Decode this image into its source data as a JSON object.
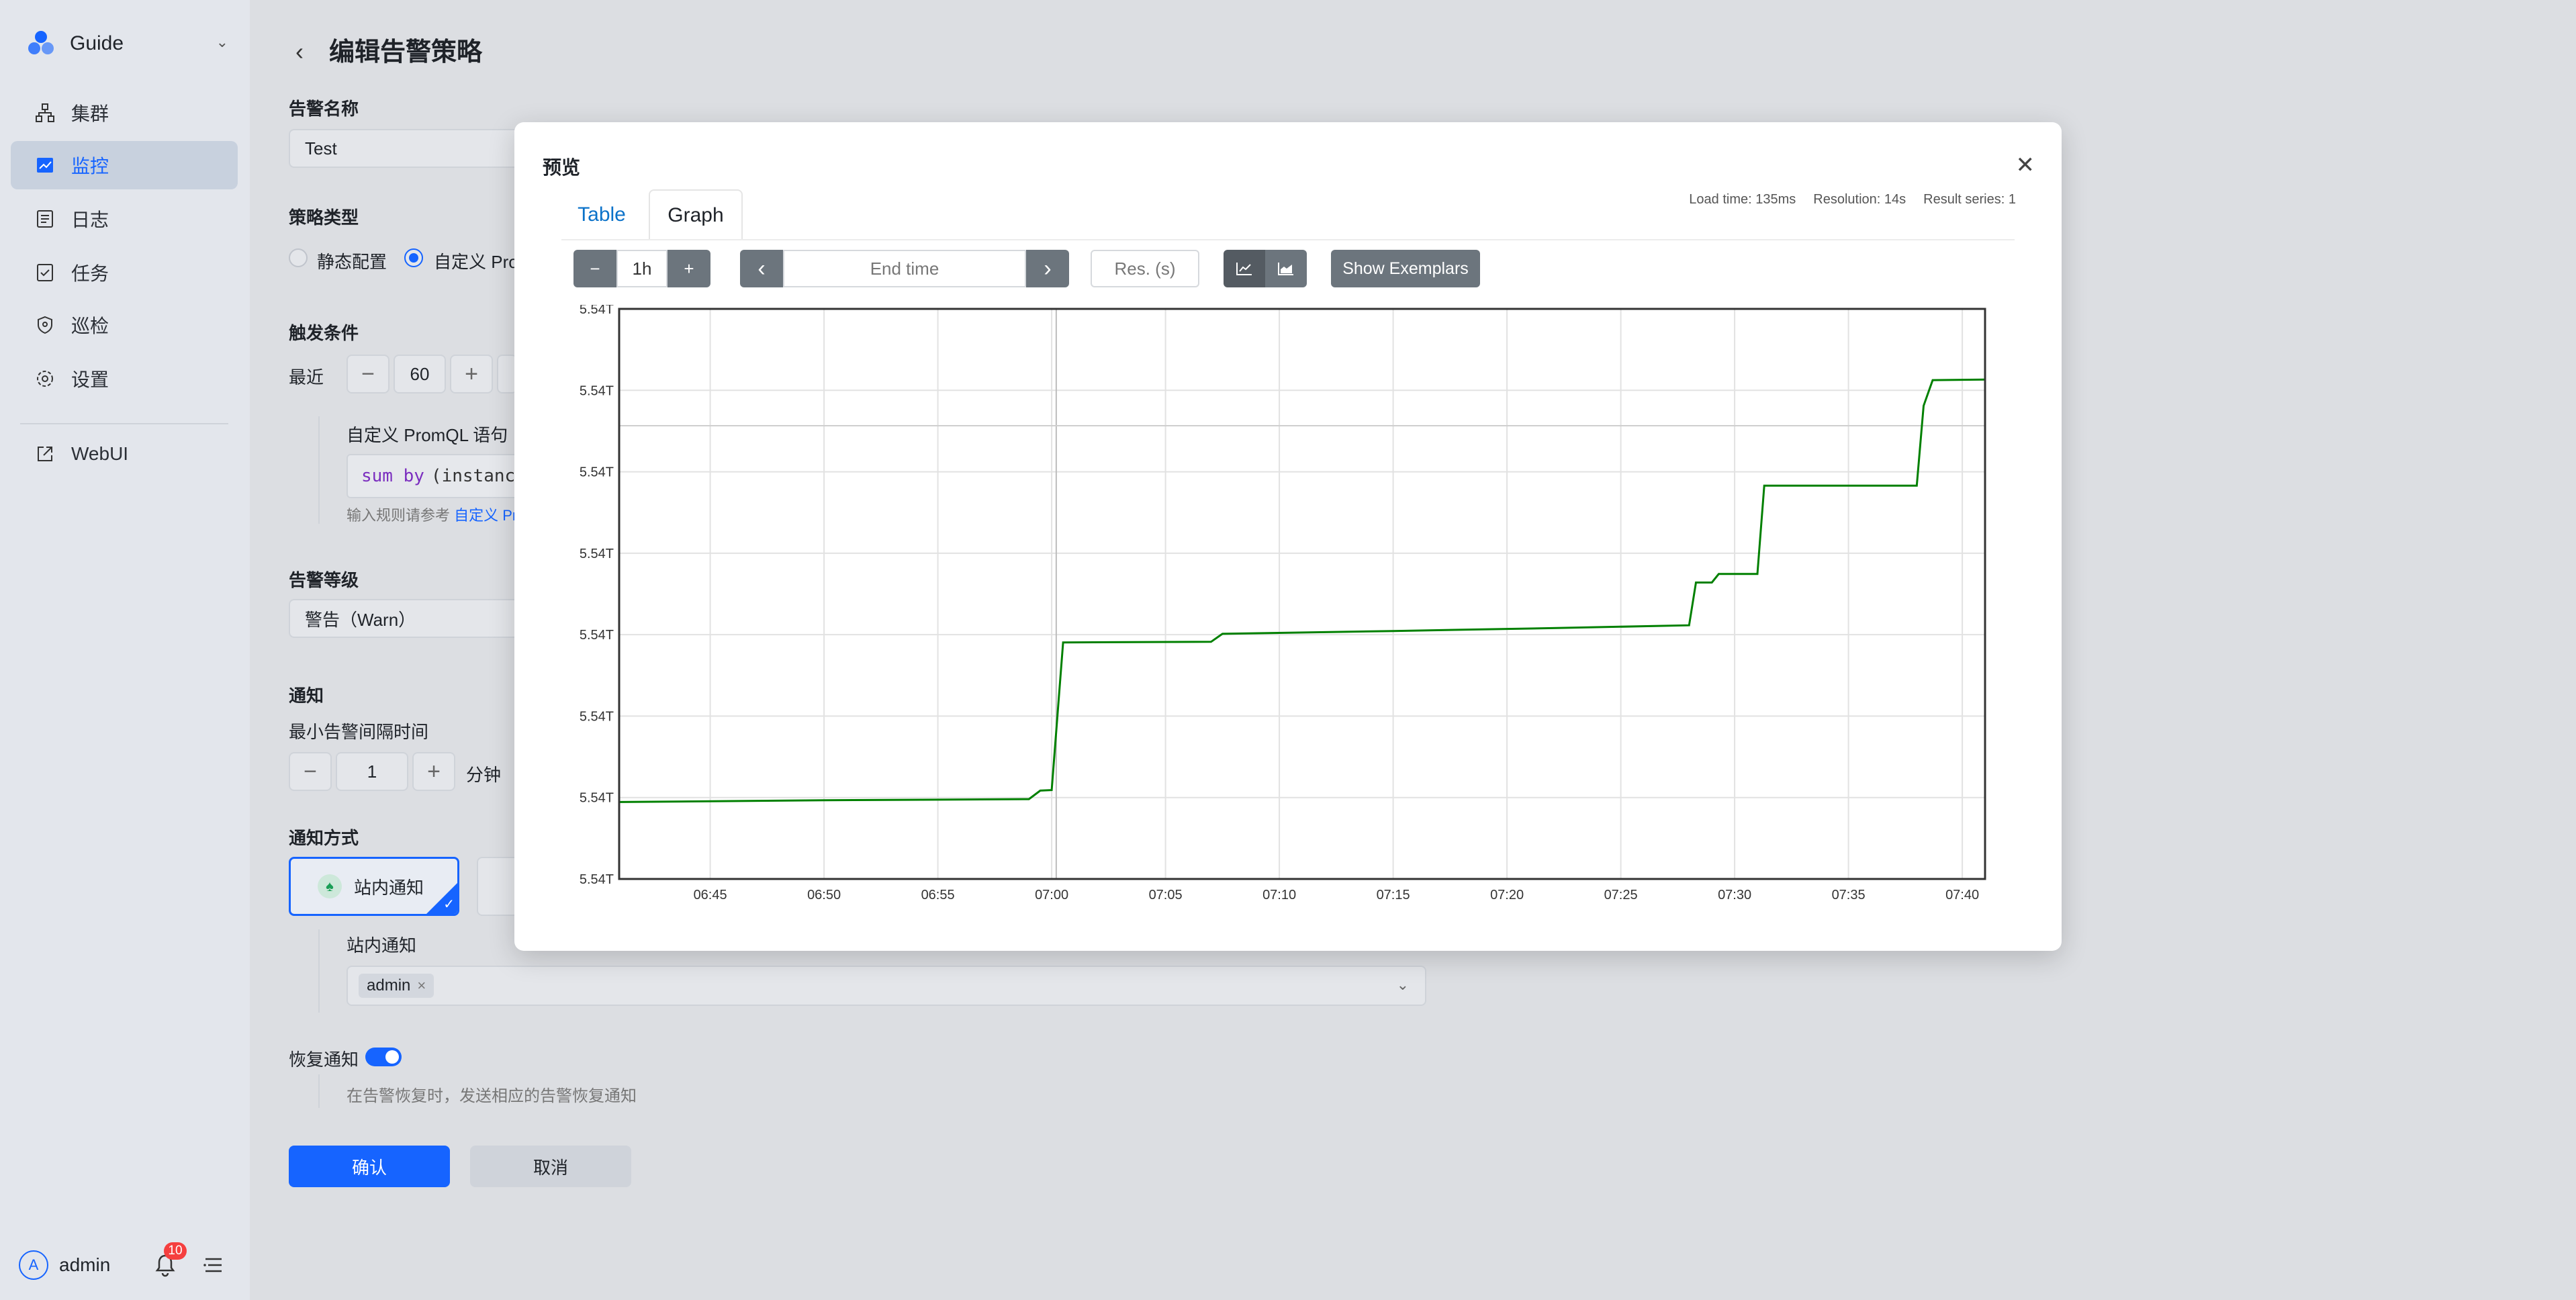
{
  "sidebar": {
    "brand": "Guide",
    "items": [
      {
        "label": "集群"
      },
      {
        "label": "监控"
      },
      {
        "label": "日志"
      },
      {
        "label": "任务"
      },
      {
        "label": "巡检"
      },
      {
        "label": "设置"
      },
      {
        "label": "WebUI"
      }
    ],
    "user": "admin",
    "notification_count": "10"
  },
  "form": {
    "title": "编辑告警策略",
    "name_label": "告警名称",
    "name_value": "Test",
    "type_label": "策略类型",
    "type_static": "静态配置",
    "type_custom": "自定义 Pro",
    "trigger_label": "触发条件",
    "recent_label": "最近",
    "recent_value": "60",
    "promql_label": "自定义 PromQL 语句",
    "promql_kw": "sum by",
    "promql_rest": "(instanc",
    "promql_hint": "输入规则请参考",
    "promql_hint_link": "自定义 Pr",
    "level_label": "告警等级",
    "level_value": "警告（Warn）",
    "notify_label": "通知",
    "interval_label": "最小告警间隔时间",
    "interval_value": "1",
    "interval_unit": "分钟",
    "method_label": "通知方式",
    "method_site": "站内通知",
    "site_label": "站内通知",
    "site_tag": "admin",
    "recover_label": "恢复通知",
    "recover_hint": "在告警恢复时，发送相应的告警恢复通知",
    "confirm": "确认",
    "cancel": "取消"
  },
  "modal": {
    "title": "预览",
    "tabs": {
      "table": "Table",
      "graph": "Graph"
    },
    "load_time": "Load time: 135ms",
    "resolution": "Resolution: 14s",
    "result_series": "Result series: 1",
    "controls": {
      "minus": "−",
      "range": "1h",
      "plus": "+",
      "prev": "‹",
      "end_time_placeholder": "End time",
      "next": "›",
      "res_placeholder": "Res. (s)",
      "show_exemplars": "Show Exemplars"
    }
  },
  "chart_data": {
    "type": "line",
    "title": "",
    "xlabel": "",
    "ylabel": "",
    "x_ticks": [
      "06:45",
      "06:50",
      "06:55",
      "07:00",
      "07:05",
      "07:10",
      "07:15",
      "07:20",
      "07:25",
      "07:30",
      "07:35",
      "07:40"
    ],
    "y_ticks": [
      "5.54T",
      "5.54T",
      "5.54T",
      "5.54T",
      "5.54T",
      "5.54T",
      "5.54T",
      "5.54T"
    ],
    "y_ticks_note_index": [
      0,
      1,
      2,
      3,
      4,
      5,
      6,
      7
    ],
    "series": [
      {
        "color": "#008000",
        "x": [
          "06:41",
          "06:50",
          "06:59",
          "06:59.5",
          "07:00",
          "07:00.5",
          "07:07",
          "07:07.5",
          "07:15",
          "07:22",
          "07:28",
          "07:28.3",
          "07:29",
          "07:29.3",
          "07:31",
          "07:31.3",
          "07:38",
          "07:38.3",
          "07:38.7",
          "07:41"
        ],
        "y": [
          0.135,
          0.138,
          0.14,
          0.155,
          0.156,
          0.415,
          0.416,
          0.43,
          0.435,
          0.44,
          0.445,
          0.52,
          0.52,
          0.535,
          0.535,
          0.69,
          0.69,
          0.83,
          0.875,
          0.876
        ]
      }
    ],
    "y_scale_note": "y values normalized 0–1 over the axis range 5.54T–5.54T",
    "grid": true,
    "legend": "none"
  }
}
